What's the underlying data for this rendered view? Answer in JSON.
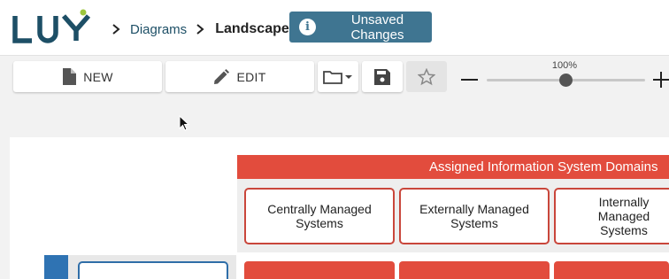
{
  "app": {
    "logo_text": "LUY"
  },
  "breadcrumb": {
    "items": [
      {
        "label": "Diagrams"
      }
    ],
    "current": "Landscape"
  },
  "status": {
    "unsaved_label": "Unsaved Changes"
  },
  "toolbar": {
    "new_label": "NEW",
    "edit_label": "EDIT"
  },
  "zoom": {
    "label": "100%",
    "level": 0.5
  },
  "diagram": {
    "header": "Assigned Information System Domains",
    "domains": [
      {
        "label": "Centrally Managed\nSystems"
      },
      {
        "label": "Externally Managed\nSystems"
      },
      {
        "label": "Internally Managed\nSystems"
      }
    ]
  },
  "colors": {
    "brand": "#1d4f66",
    "accent": "#3f7591",
    "domain_red": "#e24c3d",
    "logo_dot": "#9cc63c"
  }
}
